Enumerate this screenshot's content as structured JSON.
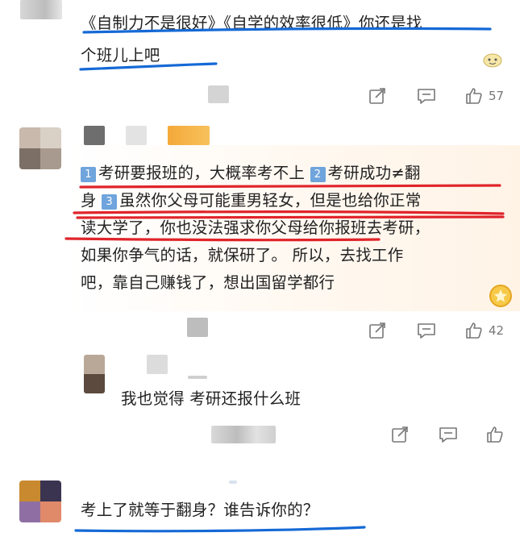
{
  "comments": [
    {
      "text_line1": "《自制力不是很好》《自学的效率很低》你还是找",
      "text_line2": "个班儿上吧",
      "likes": "57"
    },
    {
      "badge1": "1",
      "badge2": "2",
      "badge3": "3",
      "line1_a": "考研要报班的，大概率考不上",
      "line1_b": "考研成功≠翻",
      "line2_a": "身",
      "line2_b": "虽然你父母可能重男轻女，但是也给你正常",
      "line3": "读大学了，你也没法强求你父母给你报班去考研，",
      "line4": "如果你争气的话，就保研了。 所以，去找工作",
      "line5": "吧，靠自己赚钱了，想出国留学都行",
      "likes": "42"
    },
    {
      "text": "我也觉得 考研还报什么班"
    },
    {
      "text": "考上了就等于翻身？谁告诉你的？"
    }
  ],
  "colors": {
    "annotation_blue": "#1569d6",
    "annotation_red": "#e0242a",
    "icon_gray": "#777777"
  }
}
